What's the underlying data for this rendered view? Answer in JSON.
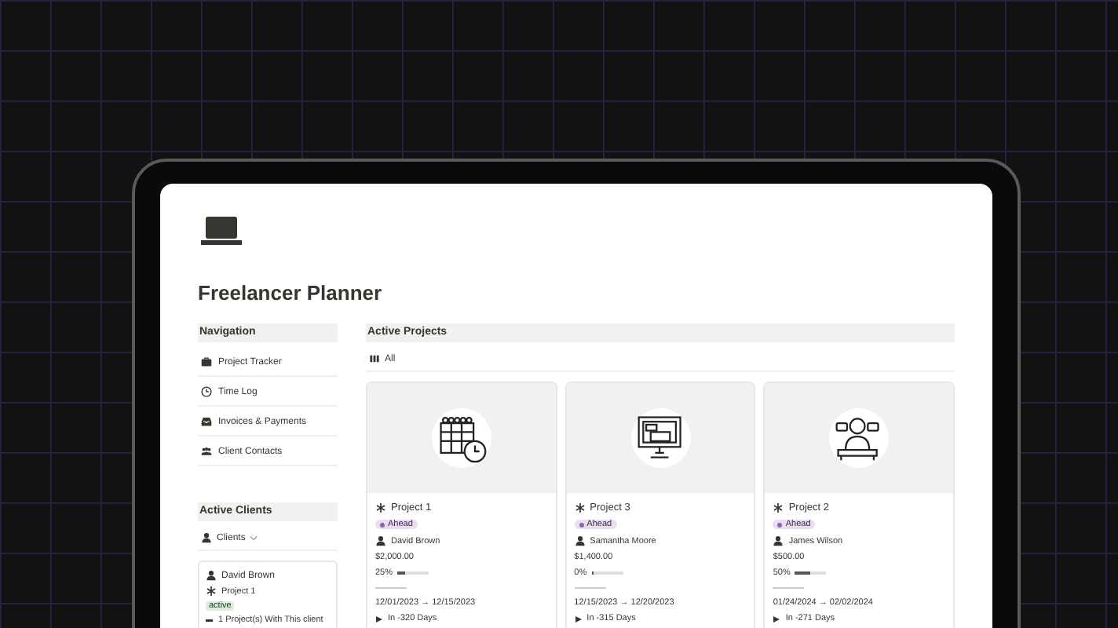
{
  "page": {
    "title": "Freelancer Planner"
  },
  "navigation": {
    "heading": "Navigation",
    "items": [
      {
        "label": "Project Tracker"
      },
      {
        "label": "Time Log"
      },
      {
        "label": "Invoices & Payments"
      },
      {
        "label": "Client Contacts"
      }
    ]
  },
  "active_clients": {
    "heading": "Active Clients",
    "view": "Clients",
    "clients": [
      {
        "name": "David Brown",
        "project": "Project 1",
        "status": "active",
        "summary": "1 Project(s) With This client"
      }
    ]
  },
  "active_projects": {
    "heading": "Active Projects",
    "view": "All",
    "projects": [
      {
        "title": "Project 1",
        "status": "Ahead",
        "client": "David Brown",
        "budget": "$2,000.00",
        "progress": "25%",
        "level": 0.25,
        "dates": "12/01/2023 → 12/15/2023",
        "due": "In -320 Days"
      },
      {
        "title": "Project 3",
        "status": "Ahead",
        "client": "Samantha Moore",
        "budget": "$1,400.00",
        "progress": "0%",
        "level": 0,
        "dates": "12/15/2023 → 12/20/2023",
        "due": "In -315 Days"
      },
      {
        "title": "Project 2",
        "status": "Ahead",
        "client": "James Wilson",
        "budget": "$500.00",
        "progress": "50%",
        "level": 0.5,
        "dates": "01/24/2024 → 02/02/2024",
        "due": "In -271 Days"
      }
    ]
  }
}
